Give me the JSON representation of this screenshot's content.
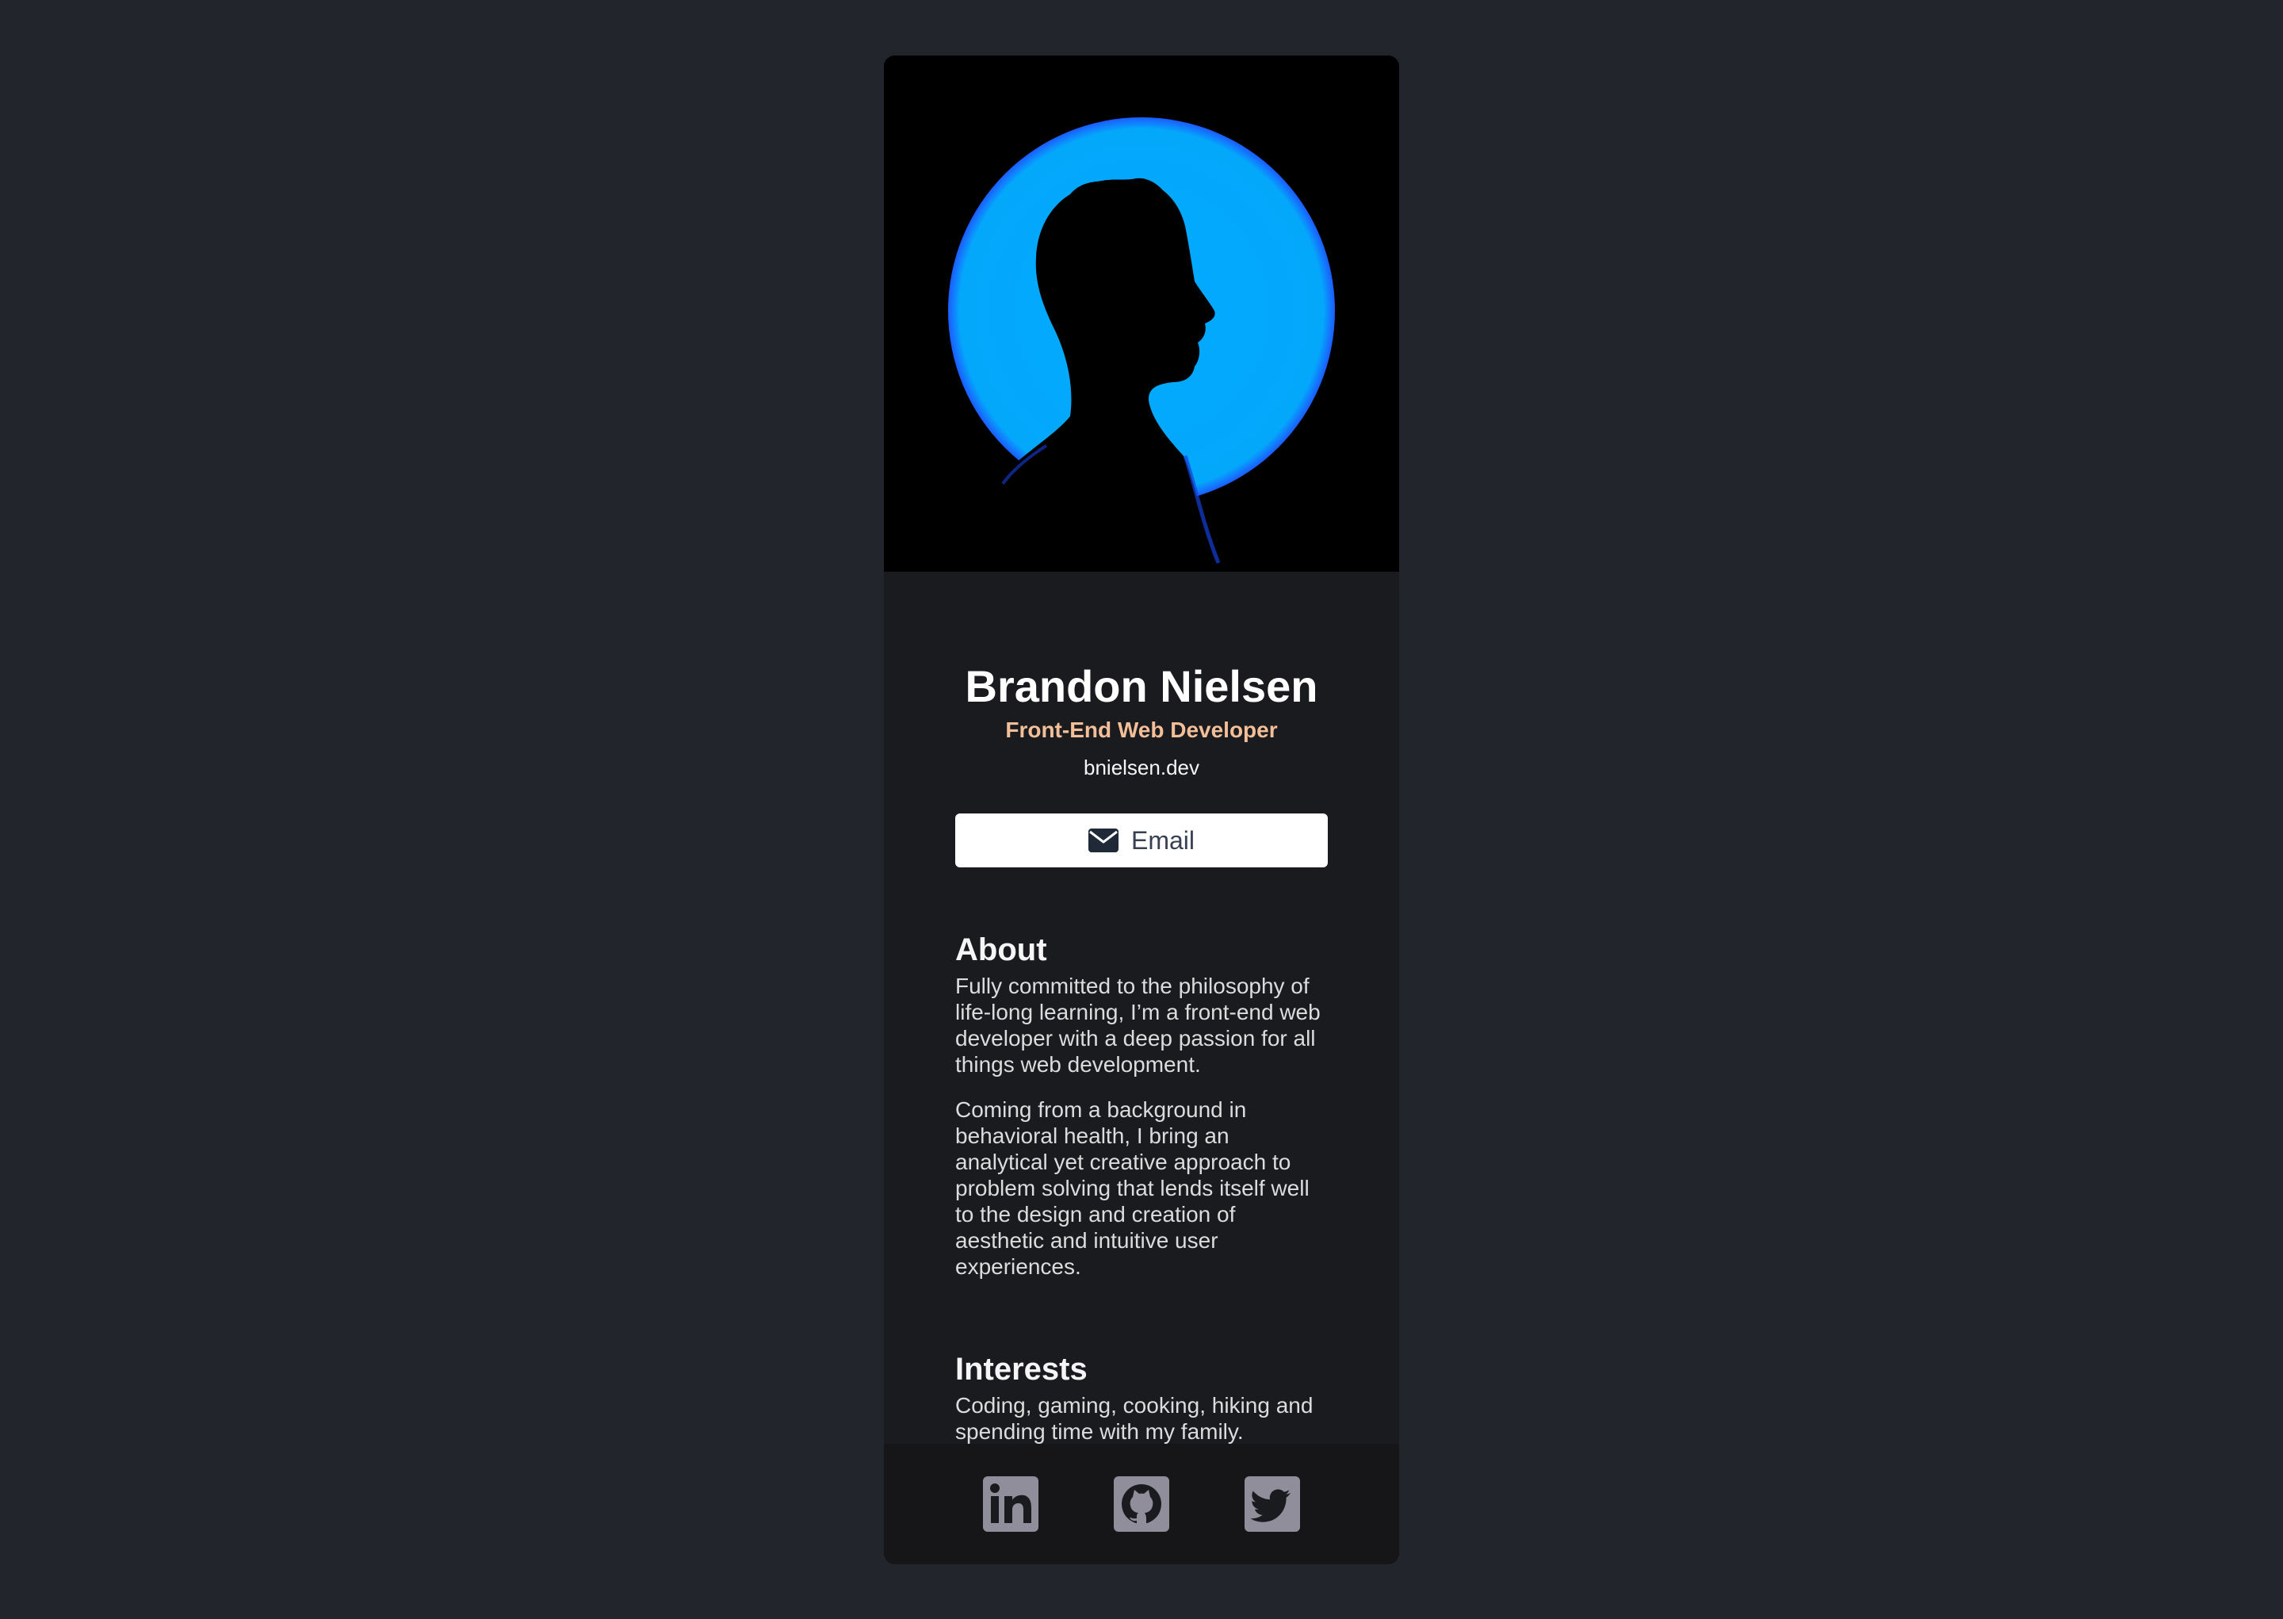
{
  "profile": {
    "name": "Brandon Nielsen",
    "title": "Front-End Web Developer",
    "website": "bnielsen.dev"
  },
  "actions": {
    "email_label": "Email",
    "email_icon": "envelope-icon"
  },
  "about": {
    "heading": "About",
    "paragraphs": [
      "Fully committed to the philosophy of life-long learning, I’m a front-end web developer with a deep passion for all things web development.",
      "Coming from a background in behavioral health, I bring an analytical yet creative approach to problem solving that lends itself well to the design and creation of aesthetic and intuitive user experiences."
    ]
  },
  "interests": {
    "heading": "Interests",
    "text": "Coding, gaming, cooking, hiking and spending time with my family."
  },
  "footer": {
    "icons": [
      "linkedin-icon",
      "github-icon",
      "twitter-icon"
    ]
  },
  "colors": {
    "page_background": "#23252c",
    "card_background": "#1a1b1f",
    "footer_background": "#161619",
    "accent_title": "#f3bf99",
    "hero_circle": "#00aaff",
    "social_icon": "#918e9b"
  }
}
